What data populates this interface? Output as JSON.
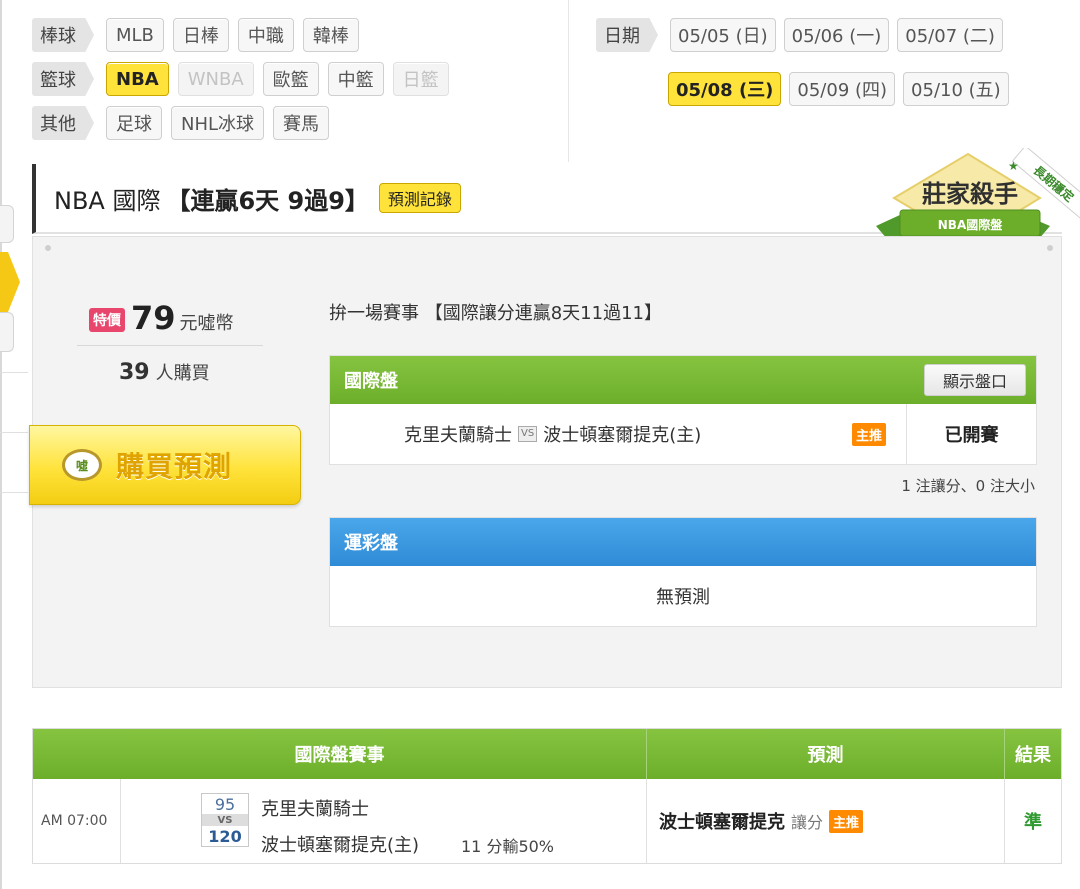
{
  "filters": {
    "rows": [
      {
        "category": "棒球",
        "chips": [
          {
            "label": "MLB",
            "state": "normal"
          },
          {
            "label": "日棒",
            "state": "normal"
          },
          {
            "label": "中職",
            "state": "normal"
          },
          {
            "label": "韓棒",
            "state": "normal"
          }
        ]
      },
      {
        "category": "籃球",
        "chips": [
          {
            "label": "NBA",
            "state": "active"
          },
          {
            "label": "WNBA",
            "state": "disabled"
          },
          {
            "label": "歐籃",
            "state": "normal"
          },
          {
            "label": "中籃",
            "state": "normal"
          },
          {
            "label": "日籃",
            "state": "disabled"
          }
        ]
      },
      {
        "category": "其他",
        "chips": [
          {
            "label": "足球",
            "state": "normal"
          },
          {
            "label": "NHL冰球",
            "state": "normal"
          },
          {
            "label": "賽馬",
            "state": "normal"
          }
        ]
      }
    ],
    "date_label": "日期",
    "dates_row1": [
      "05/05 (日)",
      "05/06 (一)",
      "05/07 (二)"
    ],
    "dates_row2": [
      "05/08 (三)",
      "05/09 (四)",
      "05/10 (五)"
    ],
    "active_date": "05/08 (三)"
  },
  "header": {
    "title": "NBA 國際",
    "streak": "【連贏6天 9過9】",
    "record_button": "預測記錄",
    "badge": {
      "main": "莊家殺手",
      "sub": "NBA國際盤",
      "corner": "長期穩定"
    }
  },
  "purchase": {
    "tag": "特價",
    "price": "79",
    "unit": "元噓幣",
    "buyers_count": "39",
    "buyers_label": "人購買",
    "buy_icon": "噓",
    "buy_label": "購買預測"
  },
  "pick": {
    "title": "拚一場賽事 【國際讓分連贏8天11過11】",
    "intl": {
      "header": "國際盤",
      "show_button": "顯示盤口",
      "away": "克里夫蘭騎士",
      "vs": "VS",
      "home": "波士頓塞爾提克(主)",
      "tag": "主推",
      "status": "已開賽"
    },
    "count_note": "1 注讓分、0 注大小",
    "lottery": {
      "header": "運彩盤",
      "empty": "無預測"
    }
  },
  "results": {
    "headers": [
      "國際盤賽事",
      "預測",
      "結果"
    ],
    "row": {
      "time": "AM 07:00",
      "away_score": "95",
      "vs": "VS",
      "home_score": "120",
      "away": "克里夫蘭騎士",
      "home": "波士頓塞爾提克(主)",
      "result_detail": "11 分輸50%",
      "pred_team": "波士頓塞爾提克",
      "pred_type": "讓分",
      "pred_tag": "主推",
      "result": "準"
    }
  },
  "colors": {
    "accent_yellow": "#ffe33b",
    "green": "#6cae2a",
    "blue": "#2f8bd6",
    "orange_tag": "#ff8a00",
    "price_tag": "#e8466d"
  }
}
